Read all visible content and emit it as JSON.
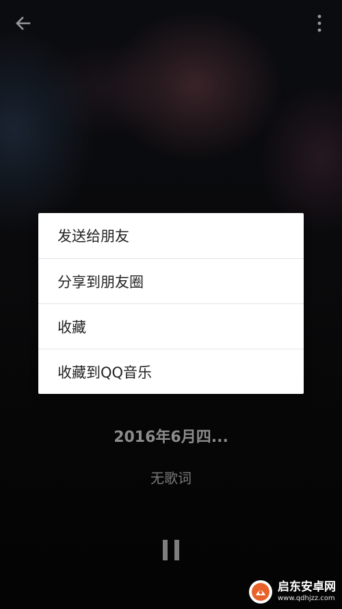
{
  "header": {
    "back_icon": "arrow-left-icon",
    "more_icon": "more-vertical-icon"
  },
  "menu": {
    "items": [
      {
        "label": "发送给朋友"
      },
      {
        "label": "分享到朋友圈"
      },
      {
        "label": "收藏"
      },
      {
        "label": "收藏到QQ音乐"
      }
    ]
  },
  "player": {
    "title": "2016年6月四...",
    "lyrics": "无歌词",
    "play_state_icon": "pause-icon"
  },
  "watermark": {
    "name": "启东安卓网",
    "url": "www.qdhjzz.com"
  },
  "colors": {
    "menu_background": "#ffffff",
    "menu_text": "#222222",
    "title_text": "#8c8c8c",
    "lyrics_text": "#7a7a7a",
    "watermark_accent": "#e8632a"
  }
}
